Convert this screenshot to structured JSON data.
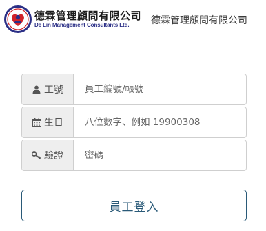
{
  "header": {
    "logo_cn": "德霖管理顧問有限公司",
    "logo_en": "De Lin Management Consultants Ltd.",
    "company_name": "德霖管理顧問有限公司"
  },
  "form": {
    "employee_id": {
      "label": "工號",
      "icon": "user-icon",
      "placeholder": "員工編號/帳號",
      "value": ""
    },
    "birthday": {
      "label": "生日",
      "icon": "calendar-icon",
      "placeholder": "八位數字、例如 19900308",
      "value": ""
    },
    "password": {
      "label": "驗證",
      "icon": "key-icon",
      "placeholder": "密碼",
      "value": ""
    },
    "login_label": "員工登入"
  },
  "colors": {
    "brand_blue": "#2b2f86",
    "brand_red": "#d2232a",
    "button_border": "#2a5a78",
    "addon_bg": "#eeeeee"
  }
}
